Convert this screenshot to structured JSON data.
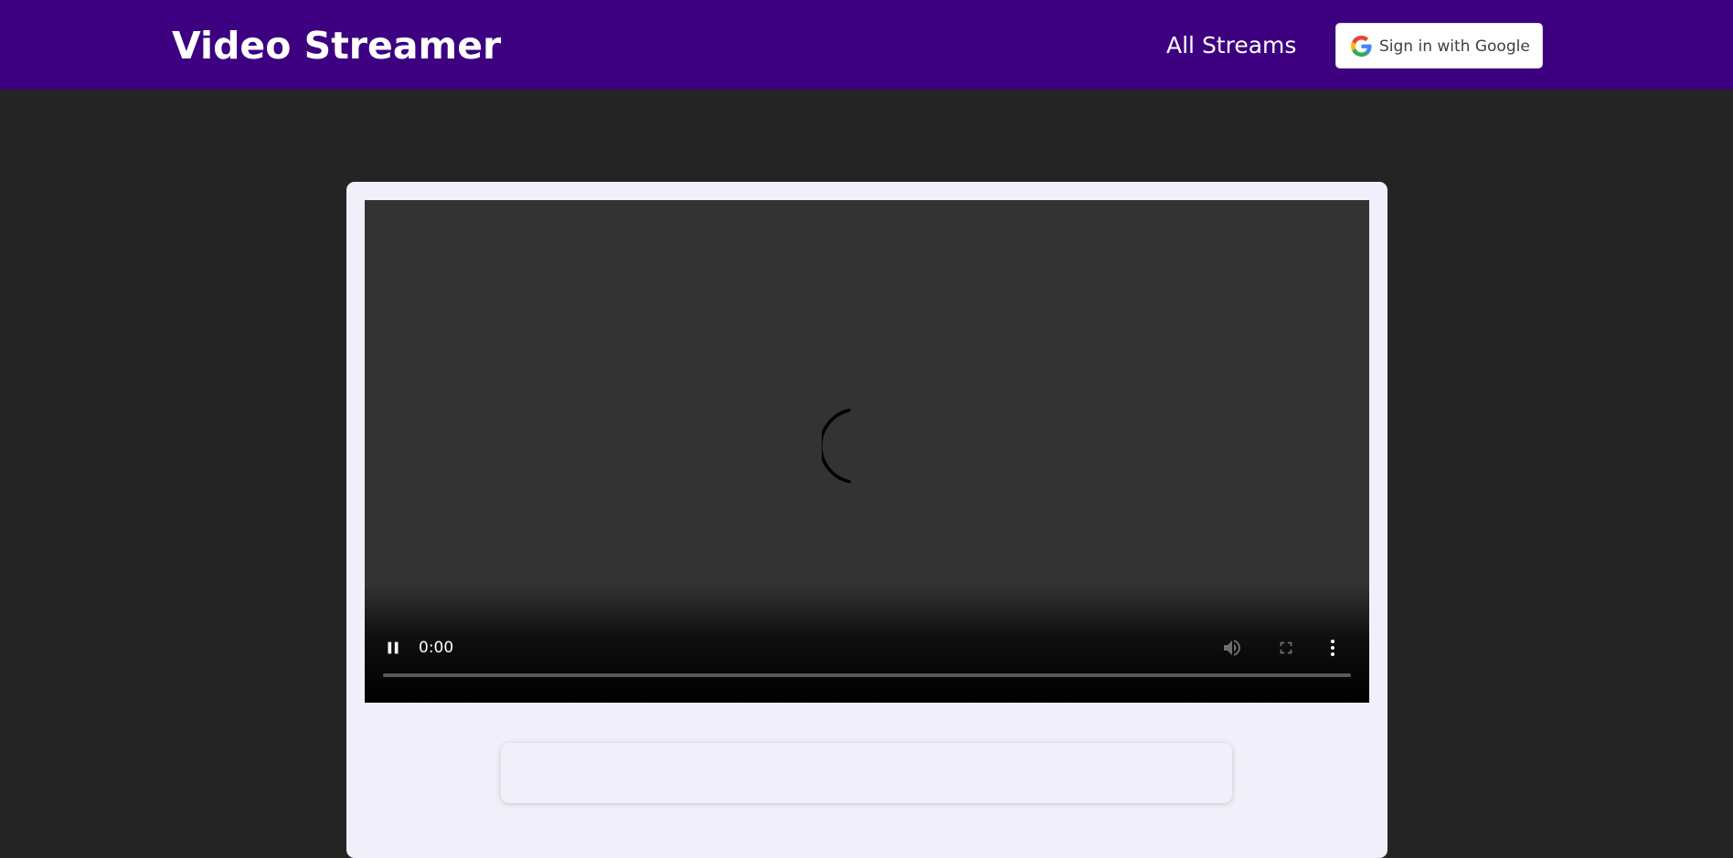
{
  "header": {
    "brand": "Video Streamer",
    "nav_link": "All Streams",
    "signin_label": "Sign in with Google"
  },
  "player": {
    "state": "loading",
    "time_display": "0:00",
    "progress_fraction": 0,
    "controls": [
      "pause-icon",
      "volume-icon",
      "fullscreen-icon",
      "more-options-icon"
    ]
  },
  "colors": {
    "navbar": "#3c0080",
    "page_background": "#242424",
    "card_background": "#f1eff9",
    "video_background": "#333333"
  }
}
